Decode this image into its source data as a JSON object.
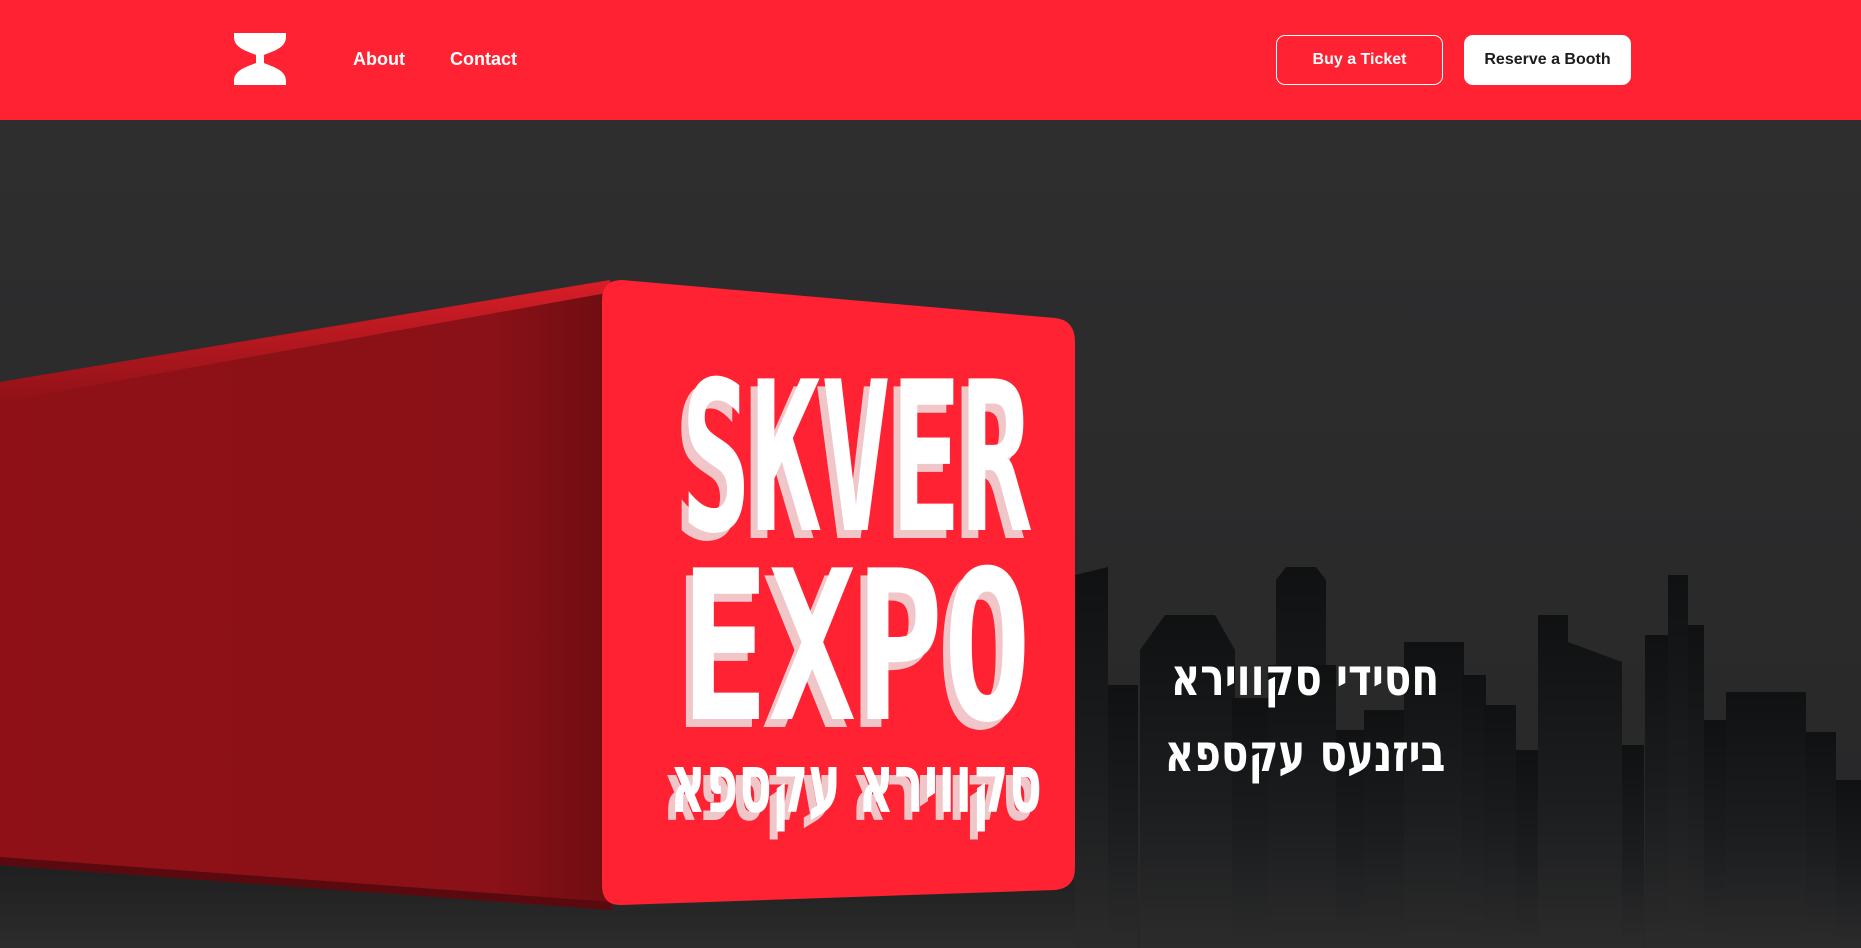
{
  "nav": {
    "logo_icon": "skver-x-logo-icon",
    "links": [
      "About",
      "Contact"
    ]
  },
  "buttons": {
    "buy_ticket": "Buy a Ticket",
    "reserve_booth": "Reserve a Booth"
  },
  "hero": {
    "logo_lines": [
      "SKVER",
      "EXPO"
    ],
    "logo_yiddish": "סקווירא עקספא",
    "tagline": [
      "חסידי סקווירא",
      "ביזנעס עקספא"
    ]
  },
  "colors": {
    "brand_red": "#ff2232",
    "background": "#2e2e2f",
    "text_light": "#ffffff"
  }
}
